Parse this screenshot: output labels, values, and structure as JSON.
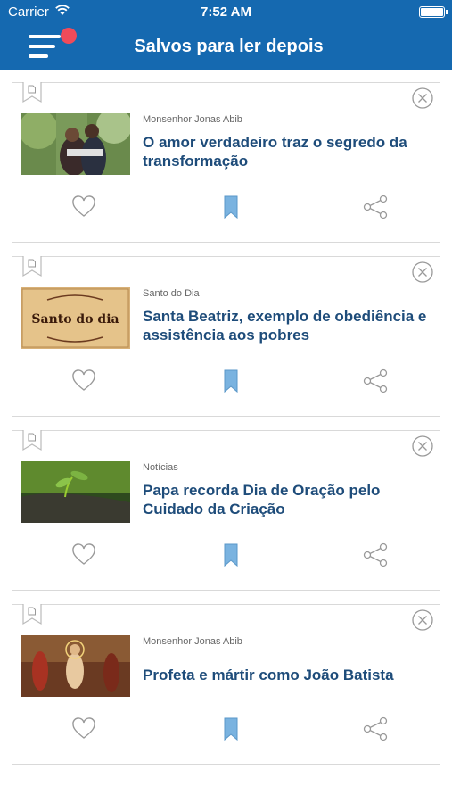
{
  "status_bar": {
    "carrier": "Carrier",
    "time": "7:52 AM"
  },
  "header": {
    "title": "Salvos para ler depois",
    "menu_icon": "menu-icon",
    "badge_color": "#f04b5a",
    "background": "#1569b0"
  },
  "articles": [
    {
      "category": "Monsenhor Jonas Abib",
      "title": "O amor verdadeiro traz o segredo da transformação"
    },
    {
      "category": "Santo do Dia",
      "title": "Santa Beatriz, exemplo de obediência e assistência aos pobres",
      "thumb_text": "Santo do dia"
    },
    {
      "category": "Notícias",
      "title": "Papa recorda Dia de Oração pelo Cuidado da Criação"
    },
    {
      "category": "Monsenhor Jonas Abib",
      "title": "Profeta e mártir como João Batista"
    }
  ],
  "icons": {
    "like": "heart-icon",
    "save": "bookmark-icon",
    "share": "share-icon",
    "remove": "close-icon"
  },
  "colors": {
    "headline": "#1e4c7a",
    "bookmark": "#7ab3e0"
  }
}
